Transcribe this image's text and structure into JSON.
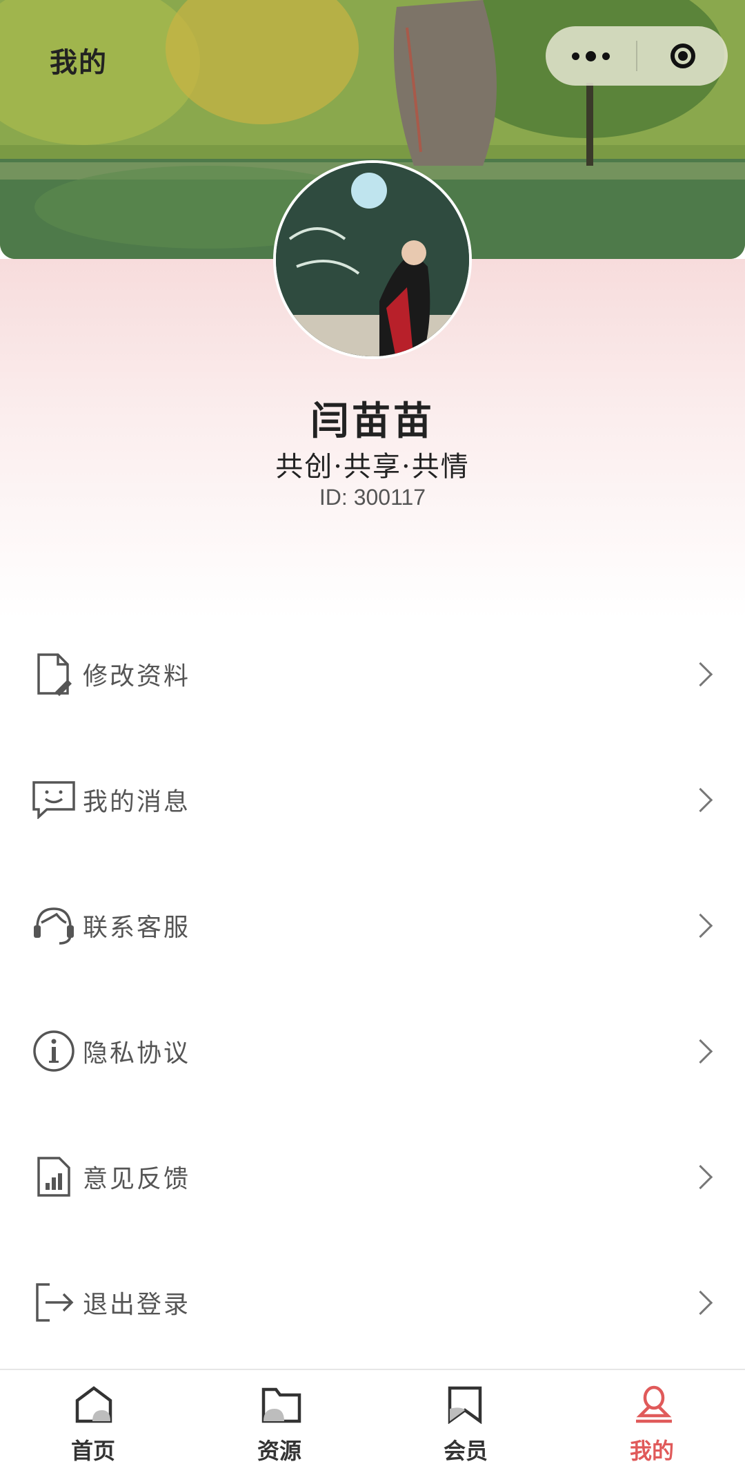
{
  "header": {
    "title": "我的",
    "capsule": {
      "more_icon": "more-dots-icon",
      "close_icon": "target-icon"
    }
  },
  "profile": {
    "name": "闫苗苗",
    "slogan": "共创·共享·共情",
    "id_text": "ID: 300117"
  },
  "menu": {
    "items": [
      {
        "label": "修改资料",
        "icon": "edit-document-icon"
      },
      {
        "label": "我的消息",
        "icon": "message-smile-icon"
      },
      {
        "label": "联系客服",
        "icon": "headset-icon"
      },
      {
        "label": "隐私协议",
        "icon": "info-icon"
      },
      {
        "label": "意见反馈",
        "icon": "feedback-chart-icon"
      },
      {
        "label": "退出登录",
        "icon": "logout-icon"
      }
    ]
  },
  "tabbar": {
    "items": [
      {
        "label": "首页",
        "icon": "home-icon"
      },
      {
        "label": "资源",
        "icon": "folder-icon"
      },
      {
        "label": "会员",
        "icon": "bookmark-icon"
      },
      {
        "label": "我的",
        "icon": "user-icon",
        "active": true
      }
    ],
    "active_color": "#e05a5a"
  }
}
